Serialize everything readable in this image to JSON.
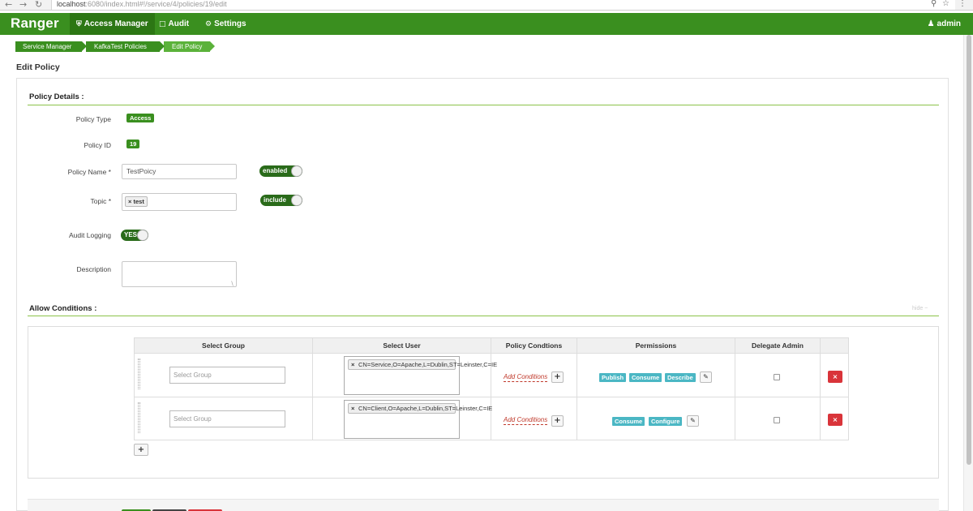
{
  "browser": {
    "url_host": "localhost",
    "url_path": ":6080/index.html#!/service/4/policies/19/edit"
  },
  "nav": {
    "brand": "Ranger",
    "access_manager": "Access Manager",
    "audit": "Audit",
    "settings": "Settings",
    "user": "admin"
  },
  "breadcrumb": [
    "Service Manager",
    "KafkaTest Policies",
    "Edit Policy"
  ],
  "page_title": "Edit Policy",
  "policy_details": {
    "heading": "Policy Details :",
    "policy_type_label": "Policy Type",
    "policy_type_value": "Access",
    "policy_id_label": "Policy ID",
    "policy_id_value": "19",
    "policy_name_label": "Policy Name *",
    "policy_name_value": "TestPoicy",
    "enabled_toggle": "enabled",
    "topic_label": "Topic *",
    "topic_chip": "test",
    "include_toggle": "include",
    "audit_label": "Audit Logging",
    "audit_toggle": "YES",
    "description_label": "Description",
    "description_value": ""
  },
  "allow_conditions": {
    "heading": "Allow Conditions :",
    "hide": "hide −",
    "columns": [
      "Select Group",
      "Select User",
      "Policy Condtions",
      "Permissions",
      "Delegate Admin"
    ],
    "group_placeholder": "Select Group",
    "add_conditions": "Add Conditions",
    "rows": [
      {
        "user": "CN=Service,O=Apache,L=Dublin,ST=Leinster,C=IE",
        "permissions": [
          "Publish",
          "Consume",
          "Describe"
        ]
      },
      {
        "user": "CN=Client,O=Apache,L=Dublin,ST=Leinster,C=IE",
        "permissions": [
          "Consume",
          "Configure"
        ]
      }
    ]
  },
  "colors": {
    "nav_green": "#3a8f1f",
    "permission_tag": "#4bb7c4",
    "delete_red": "#d9343a"
  }
}
